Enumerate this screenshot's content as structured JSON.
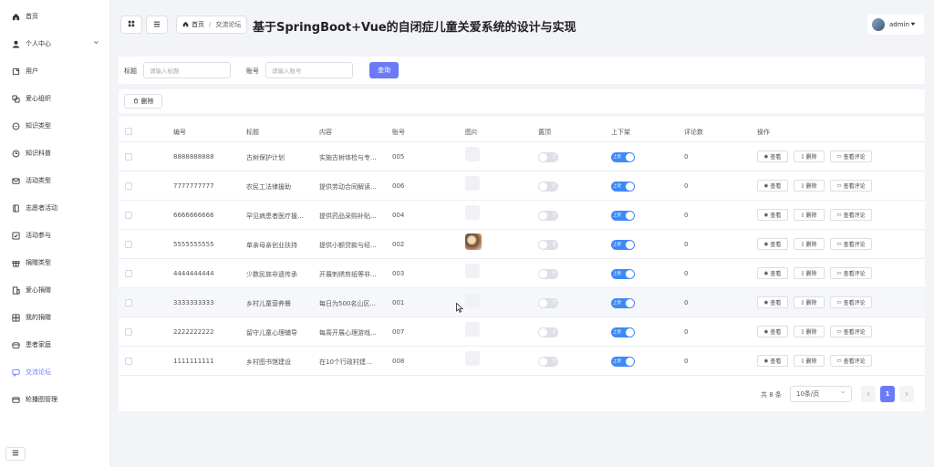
{
  "sidebar": {
    "items": [
      {
        "label": "首页",
        "icon": "home-icon"
      },
      {
        "label": "个人中心",
        "icon": "user-icon"
      },
      {
        "label": "用户",
        "icon": "user-card-icon"
      },
      {
        "label": "爱心组织",
        "icon": "organization-icon"
      },
      {
        "label": "知识类型",
        "icon": "chat-icon"
      },
      {
        "label": "知识科普",
        "icon": "clock-icon"
      },
      {
        "label": "活动类型",
        "icon": "mail-icon"
      },
      {
        "label": "志愿者活动",
        "icon": "book-icon"
      },
      {
        "label": "活动参与",
        "icon": "check-box-icon"
      },
      {
        "label": "捐赠类型",
        "icon": "gift-icon"
      },
      {
        "label": "爱心捐赠",
        "icon": "building-icon"
      },
      {
        "label": "我的捐赠",
        "icon": "grid-icon"
      },
      {
        "label": "患者家庭",
        "icon": "wallet-icon"
      },
      {
        "label": "交流论坛",
        "icon": "forum-icon"
      },
      {
        "label": "轮播图管理",
        "icon": "carousel-icon"
      }
    ]
  },
  "header": {
    "breadcrumb_home": "首页",
    "breadcrumb_separator": "/",
    "breadcrumb_current": "交流论坛",
    "title": "基于SpringBoot+Vue的自闭症儿童关爱系统的设计与实现",
    "user_name": "admin"
  },
  "search": {
    "title_label": "标题",
    "title_placeholder": "请输入标题",
    "account_label": "账号",
    "account_placeholder": "请输入账号",
    "query_button": "查询"
  },
  "actions": {
    "delete_button": "删除"
  },
  "table": {
    "columns": [
      "编号",
      "标题",
      "内容",
      "账号",
      "图片",
      "置顶",
      "上下架",
      "评论数",
      "操作"
    ],
    "toggle_off_text": "否",
    "toggle_on_text": "上架",
    "op_view": "查看",
    "op_delete": "删除",
    "op_comments": "查看评论",
    "rows": [
      {
        "id": "8888888888",
        "title": "古树保护计划",
        "content": "实施古树体检与专...",
        "account": "005",
        "has_image": false,
        "comments": "0"
      },
      {
        "id": "7777777777",
        "title": "农民工法律援助",
        "content": "提供劳动合同解读...",
        "account": "006",
        "has_image": false,
        "comments": "0"
      },
      {
        "id": "6666666666",
        "title": "罕见病患者医疗援...",
        "content": "提供药品采购补贴...",
        "account": "004",
        "has_image": false,
        "comments": "0"
      },
      {
        "id": "5555555555",
        "title": "单亲母亲创业扶持",
        "content": "提供小额贷款与经...",
        "account": "002",
        "has_image": true,
        "comments": "0"
      },
      {
        "id": "4444444444",
        "title": "少数民族非遗传承",
        "content": "开展刺绣剪纸等非...",
        "account": "003",
        "has_image": false,
        "comments": "0"
      },
      {
        "id": "3333333333",
        "title": "乡村儿童营养餐",
        "content": "每日为500名山区...",
        "account": "001",
        "has_image": false,
        "comments": "0"
      },
      {
        "id": "2222222222",
        "title": "留守儿童心理辅导",
        "content": "每周开展心理游戏...",
        "account": "007",
        "has_image": false,
        "comments": "0"
      },
      {
        "id": "1111111111",
        "title": "乡村图书馆建设",
        "content": "在10个行政村建...",
        "account": "008",
        "has_image": false,
        "comments": "0"
      }
    ]
  },
  "pagination": {
    "total_text": "共 8 条",
    "page_size": "10条/页",
    "current_page": "1"
  },
  "colors": {
    "accent": "#6b7bf7",
    "toggle_on": "#3d8af7",
    "toggle_off": "#dcdfe6"
  }
}
